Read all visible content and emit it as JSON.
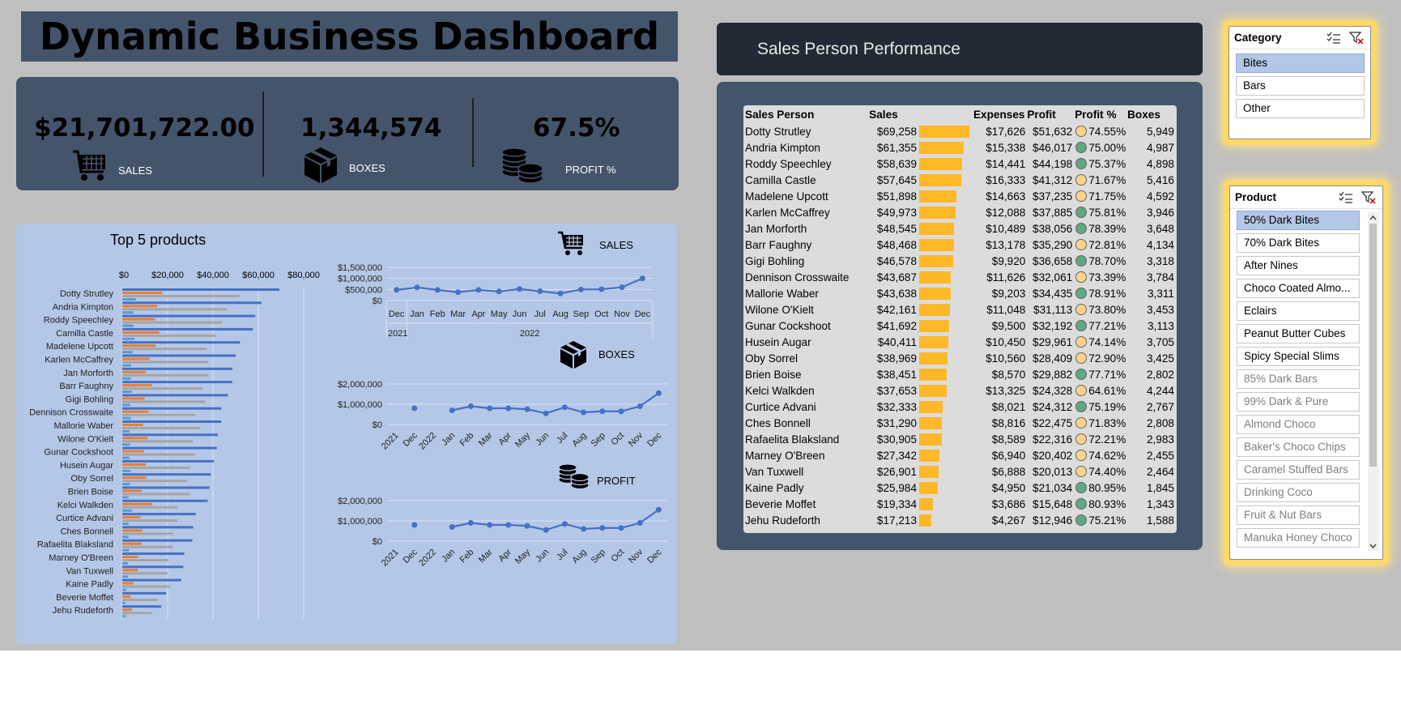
{
  "title": "Dynamic Business Dashboard",
  "kpis": {
    "sales": {
      "value": "$21,701,722.00",
      "label": "SALES",
      "icon": "shopping-cart-icon"
    },
    "boxes": {
      "value": "1,344,574",
      "label": "BOXES",
      "icon": "box-icon"
    },
    "profit": {
      "value": "67.5%",
      "label": "PROFIT %",
      "icon": "coin-stack-icon"
    }
  },
  "colors": {
    "panel": "#44546a",
    "chart_bg": "#b4c7e7",
    "accent_blue": "#4472c4",
    "accent_orange": "#ed7d31",
    "accent_gray": "#a5a5a5",
    "databar": "#ffb828",
    "dot_green": "#5fa884",
    "dot_amber": "#ffd38a",
    "slicer_glow": "#ffd966"
  },
  "charts": {
    "top5_title": "Top 5 products",
    "sales_label": "SALES",
    "boxes_label": "BOXES",
    "profit_label": "PROFIT"
  },
  "chart_data": [
    {
      "type": "bar",
      "orientation": "horizontal",
      "title": "Top 5 products",
      "categories": [
        "Dotty Strutley",
        "Andria Kimpton",
        "Roddy Speechley",
        "Camilla Castle",
        "Madelene Upcott",
        "Karlen McCaffrey",
        "Jan Morforth",
        "Barr Faughny",
        "Gigi Bohling",
        "Dennison Crosswaite",
        "Mallorie Waber",
        "Wilone O'Kielt",
        "Gunar Cockshoot",
        "Husein Augar",
        "Oby Sorrel",
        "Brien Boise",
        "Kelci Walkden",
        "Curtice Advani",
        "Ches Bonnell",
        "Rafaelita Blaksland",
        "Marney O'Breen",
        "Van Tuxwell",
        "Kaine Padly",
        "Beverie Moffet",
        "Jehu Rudeforth"
      ],
      "series": [
        {
          "color": "#4472c4",
          "values": [
            69258,
            61355,
            58639,
            57645,
            51898,
            49973,
            48545,
            48468,
            46578,
            43687,
            43638,
            42161,
            41692,
            40411,
            38969,
            38451,
            37653,
            32333,
            31290,
            30905,
            27342,
            26901,
            25984,
            19334,
            17213
          ]
        },
        {
          "color": "#ed7d31",
          "values": [
            17626,
            15338,
            14441,
            16333,
            14663,
            12088,
            10489,
            13178,
            9920,
            11626,
            9203,
            11048,
            9500,
            10450,
            10560,
            8570,
            13325,
            8021,
            8816,
            8589,
            6940,
            6888,
            4950,
            3686,
            4267
          ]
        },
        {
          "color": "#a5a5a5",
          "values": [
            51632,
            46017,
            44198,
            41312,
            37235,
            37885,
            38056,
            35290,
            36658,
            32061,
            34435,
            31113,
            32192,
            29961,
            28409,
            29882,
            24328,
            24312,
            22475,
            22316,
            20402,
            20013,
            21034,
            15648,
            12946
          ]
        },
        {
          "color": "#5b9bd5",
          "values": [
            5949,
            4987,
            4898,
            5416,
            4592,
            3946,
            3648,
            4134,
            3318,
            3784,
            3311,
            3453,
            3113,
            3705,
            3425,
            2802,
            4244,
            2767,
            2808,
            2983,
            2455,
            2464,
            1845,
            1343,
            1588
          ]
        }
      ],
      "xticks": [
        "$0",
        "$20,000",
        "$40,000",
        "$60,000",
        "$80,000"
      ],
      "xlim": [
        0,
        80000
      ]
    },
    {
      "type": "line",
      "title": "SALES",
      "x": [
        "Dec",
        "Jan",
        "Feb",
        "Mar",
        "Apr",
        "May",
        "Jun",
        "Jul",
        "Aug",
        "Sep",
        "Oct",
        "Nov",
        "Dec"
      ],
      "years": [
        "2021",
        "2022"
      ],
      "values": [
        480000,
        590000,
        480000,
        380000,
        480000,
        410000,
        520000,
        420000,
        320000,
        500000,
        510000,
        600000,
        1000000
      ],
      "yticks": [
        "$1,500,000",
        "$1,000,000",
        "$500,000",
        "$0"
      ],
      "ylim": [
        0,
        1500000
      ]
    },
    {
      "type": "line",
      "title": "BOXES",
      "x": [
        "2021",
        "Dec",
        "2022",
        "Jan",
        "Feb",
        "Mar",
        "Apr",
        "May",
        "Jun",
        "Jul",
        "Aug",
        "Sep",
        "Oct",
        "Nov",
        "Dec"
      ],
      "values": [
        null,
        800000,
        null,
        700000,
        900000,
        800000,
        800000,
        750000,
        550000,
        850000,
        600000,
        650000,
        650000,
        900000,
        1550000
      ],
      "yticks": [
        "$2,000,000",
        "$1,000,000",
        "$0"
      ],
      "ylim": [
        0,
        2000000
      ]
    },
    {
      "type": "line",
      "title": "PROFIT",
      "x": [
        "2021",
        "Dec",
        "2022",
        "Jan",
        "Feb",
        "Mar",
        "Apr",
        "May",
        "Jun",
        "Jul",
        "Aug",
        "Sep",
        "Oct",
        "Nov",
        "Dec"
      ],
      "values": [
        null,
        800000,
        null,
        700000,
        900000,
        800000,
        800000,
        750000,
        550000,
        850000,
        600000,
        650000,
        650000,
        900000,
        1550000
      ],
      "yticks": [
        "$2,000,000",
        "$1,000,000",
        "$0"
      ],
      "ylim": [
        0,
        2000000
      ]
    }
  ],
  "performance": {
    "header": "Sales Person Performance",
    "columns": [
      "Sales Person",
      "Sales",
      "",
      "Expenses",
      "Profit",
      "Profit %",
      "Boxes"
    ],
    "rows": [
      {
        "name": "Dotty Strutley",
        "sales": "$69,258",
        "bar": 1.0,
        "expenses": "$17,626",
        "profit": "$51,632",
        "pct": "74.55%",
        "dot": "amber",
        "boxes": "5,949"
      },
      {
        "name": "Andria Kimpton",
        "sales": "$61,355",
        "bar": 0.886,
        "expenses": "$15,338",
        "profit": "$46,017",
        "pct": "75.00%",
        "dot": "green",
        "boxes": "4,987"
      },
      {
        "name": "Roddy Speechley",
        "sales": "$58,639",
        "bar": 0.847,
        "expenses": "$14,441",
        "profit": "$44,198",
        "pct": "75.37%",
        "dot": "green",
        "boxes": "4,898"
      },
      {
        "name": "Camilla Castle",
        "sales": "$57,645",
        "bar": 0.832,
        "expenses": "$16,333",
        "profit": "$41,312",
        "pct": "71.67%",
        "dot": "amber",
        "boxes": "5,416"
      },
      {
        "name": "Madelene Upcott",
        "sales": "$51,898",
        "bar": 0.749,
        "expenses": "$14,663",
        "profit": "$37,235",
        "pct": "71.75%",
        "dot": "amber",
        "boxes": "4,592"
      },
      {
        "name": "Karlen McCaffrey",
        "sales": "$49,973",
        "bar": 0.722,
        "expenses": "$12,088",
        "profit": "$37,885",
        "pct": "75.81%",
        "dot": "green",
        "boxes": "3,946"
      },
      {
        "name": "Jan Morforth",
        "sales": "$48,545",
        "bar": 0.701,
        "expenses": "$10,489",
        "profit": "$38,056",
        "pct": "78.39%",
        "dot": "green",
        "boxes": "3,648"
      },
      {
        "name": "Barr Faughny",
        "sales": "$48,468",
        "bar": 0.7,
        "expenses": "$13,178",
        "profit": "$35,290",
        "pct": "72.81%",
        "dot": "amber",
        "boxes": "4,134"
      },
      {
        "name": "Gigi Bohling",
        "sales": "$46,578",
        "bar": 0.673,
        "expenses": "$9,920",
        "profit": "$36,658",
        "pct": "78.70%",
        "dot": "green",
        "boxes": "3,318"
      },
      {
        "name": "Dennison Crosswaite",
        "sales": "$43,687",
        "bar": 0.631,
        "expenses": "$11,626",
        "profit": "$32,061",
        "pct": "73.39%",
        "dot": "amber",
        "boxes": "3,784"
      },
      {
        "name": "Mallorie Waber",
        "sales": "$43,638",
        "bar": 0.63,
        "expenses": "$9,203",
        "profit": "$34,435",
        "pct": "78.91%",
        "dot": "green",
        "boxes": "3,311"
      },
      {
        "name": "Wilone O'Kielt",
        "sales": "$42,161",
        "bar": 0.609,
        "expenses": "$11,048",
        "profit": "$31,113",
        "pct": "73.80%",
        "dot": "amber",
        "boxes": "3,453"
      },
      {
        "name": "Gunar Cockshoot",
        "sales": "$41,692",
        "bar": 0.602,
        "expenses": "$9,500",
        "profit": "$32,192",
        "pct": "77.21%",
        "dot": "green",
        "boxes": "3,113"
      },
      {
        "name": "Husein Augar",
        "sales": "$40,411",
        "bar": 0.583,
        "expenses": "$10,450",
        "profit": "$29,961",
        "pct": "74.14%",
        "dot": "amber",
        "boxes": "3,705"
      },
      {
        "name": "Oby Sorrel",
        "sales": "$38,969",
        "bar": 0.563,
        "expenses": "$10,560",
        "profit": "$28,409",
        "pct": "72.90%",
        "dot": "amber",
        "boxes": "3,425"
      },
      {
        "name": "Brien Boise",
        "sales": "$38,451",
        "bar": 0.555,
        "expenses": "$8,570",
        "profit": "$29,882",
        "pct": "77.71%",
        "dot": "green",
        "boxes": "2,802"
      },
      {
        "name": "Kelci Walkden",
        "sales": "$37,653",
        "bar": 0.544,
        "expenses": "$13,325",
        "profit": "$24,328",
        "pct": "64.61%",
        "dot": "amber",
        "boxes": "4,244"
      },
      {
        "name": "Curtice Advani",
        "sales": "$32,333",
        "bar": 0.467,
        "expenses": "$8,021",
        "profit": "$24,312",
        "pct": "75.19%",
        "dot": "green",
        "boxes": "2,767"
      },
      {
        "name": "Ches Bonnell",
        "sales": "$31,290",
        "bar": 0.452,
        "expenses": "$8,816",
        "profit": "$22,475",
        "pct": "71.83%",
        "dot": "amber",
        "boxes": "2,808"
      },
      {
        "name": "Rafaelita Blaksland",
        "sales": "$30,905",
        "bar": 0.446,
        "expenses": "$8,589",
        "profit": "$22,316",
        "pct": "72.21%",
        "dot": "amber",
        "boxes": "2,983"
      },
      {
        "name": "Marney O'Breen",
        "sales": "$27,342",
        "bar": 0.395,
        "expenses": "$6,940",
        "profit": "$20,402",
        "pct": "74.62%",
        "dot": "amber",
        "boxes": "2,455"
      },
      {
        "name": "Van Tuxwell",
        "sales": "$26,901",
        "bar": 0.388,
        "expenses": "$6,888",
        "profit": "$20,013",
        "pct": "74.40%",
        "dot": "amber",
        "boxes": "2,464"
      },
      {
        "name": "Kaine Padly",
        "sales": "$25,984",
        "bar": 0.375,
        "expenses": "$4,950",
        "profit": "$21,034",
        "pct": "80.95%",
        "dot": "green",
        "boxes": "1,845"
      },
      {
        "name": "Beverie Moffet",
        "sales": "$19,334",
        "bar": 0.279,
        "expenses": "$3,686",
        "profit": "$15,648",
        "pct": "80.93%",
        "dot": "green",
        "boxes": "1,343"
      },
      {
        "name": "Jehu Rudeforth",
        "sales": "$17,213",
        "bar": 0.249,
        "expenses": "$4,267",
        "profit": "$12,946",
        "pct": "75.21%",
        "dot": "green",
        "boxes": "1,588"
      }
    ]
  },
  "category_slicer": {
    "title": "Category",
    "items": [
      {
        "label": "Bites",
        "state": "sel"
      },
      {
        "label": "Bars",
        "state": ""
      },
      {
        "label": "Other",
        "state": ""
      }
    ]
  },
  "product_slicer": {
    "title": "Product",
    "items": [
      {
        "label": "50% Dark Bites",
        "state": "sel"
      },
      {
        "label": "70% Dark Bites",
        "state": ""
      },
      {
        "label": "After Nines",
        "state": ""
      },
      {
        "label": "Choco Coated Almo...",
        "state": ""
      },
      {
        "label": "Eclairs",
        "state": ""
      },
      {
        "label": "Peanut Butter Cubes",
        "state": ""
      },
      {
        "label": "Spicy Special Slims",
        "state": ""
      },
      {
        "label": "85% Dark Bars",
        "state": "dim"
      },
      {
        "label": "99% Dark & Pure",
        "state": "dim"
      },
      {
        "label": "Almond Choco",
        "state": "dim"
      },
      {
        "label": "Baker's Choco Chips",
        "state": "dim"
      },
      {
        "label": "Caramel Stuffed Bars",
        "state": "dim"
      },
      {
        "label": "Drinking Coco",
        "state": "dim"
      },
      {
        "label": "Fruit & Nut Bars",
        "state": "dim"
      },
      {
        "label": "Manuka Honey Choco",
        "state": "dim"
      }
    ]
  }
}
